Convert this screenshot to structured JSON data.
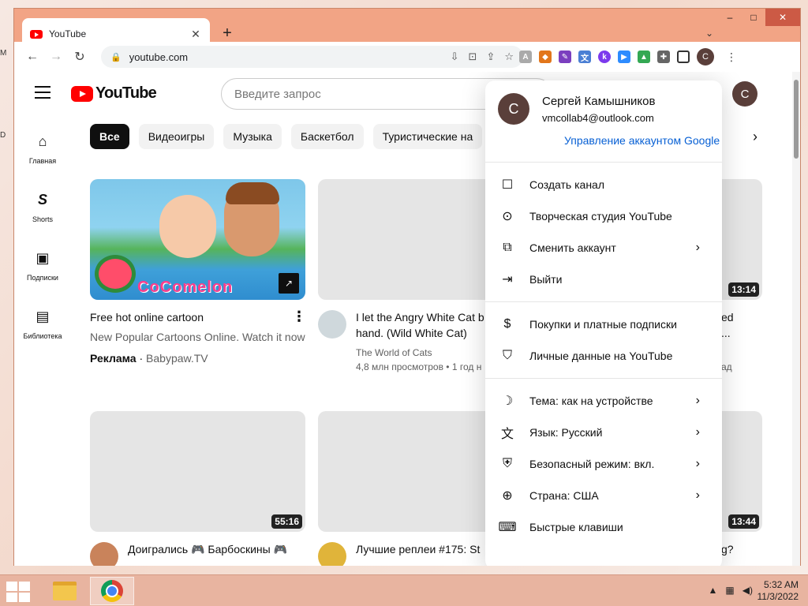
{
  "window": {
    "controls": {
      "minimize": "–",
      "maximize": "□",
      "close": "✕"
    },
    "tab": {
      "title": "YouTube",
      "close": "✕"
    },
    "new_tab": "+",
    "tab_menu": "⌄"
  },
  "toolbar": {
    "back": "←",
    "forward": "→",
    "reload": "↻",
    "url": "youtube.com",
    "lock_icon": "🔒",
    "profile_initial": "C"
  },
  "youtube": {
    "logo_text": "YouTube",
    "search_placeholder": "Введите запрос",
    "avatar_initial": "C",
    "guide": [
      {
        "icon": "⌂",
        "label": "Главная"
      },
      {
        "icon": "S",
        "label": "Shorts"
      },
      {
        "icon": "▣",
        "label": "Подписки"
      },
      {
        "icon": "▤",
        "label": "Библиотека"
      }
    ],
    "chips": [
      "Все",
      "Видеоигры",
      "Музыка",
      "Баскетбол",
      "Туристические на"
    ],
    "chip_next": "›",
    "videos": {
      "ad": {
        "title": "Free hot online cartoon",
        "desc": "New Popular Cartoons Online. Watch it now",
        "badge": "Реклама",
        "separator": "·",
        "advertiser": "Babypaw.TV",
        "brand": "CoComelon"
      },
      "v2": {
        "title_line1": "I let the Angry White Cat b",
        "title_line2": "hand. (Wild White Cat)",
        "channel": "The World of Cats",
        "meta": "4,8 млн просмотров • 1 год н"
      },
      "v3": {
        "duration": "13:14",
        "title_line1": "ed",
        "title_line2": "...",
        "meta": "ад"
      },
      "v4": {
        "duration": "55:16",
        "title": "Доигрались 🎮 Барбоскины 🎮"
      },
      "v5": {
        "title": "Лучшие реплеи #175: St"
      },
      "v6": {
        "duration": "13:44",
        "title": "g?"
      }
    }
  },
  "account_menu": {
    "avatar_initial": "C",
    "name": "Сергей Камышников",
    "email": "vmcollab4@outlook.com",
    "manage": "Управление аккаунтом Google",
    "sections": [
      [
        {
          "icon": "☐",
          "label": "Создать канал",
          "arrow": ""
        },
        {
          "icon": "⊙",
          "label": "Творческая студия YouTube",
          "arrow": ""
        },
        {
          "icon": "⧉",
          "label": "Сменить аккаунт",
          "arrow": "›"
        },
        {
          "icon": "⇥",
          "label": "Выйти",
          "arrow": ""
        }
      ],
      [
        {
          "icon": "$",
          "label": "Покупки и платные подписки",
          "arrow": ""
        },
        {
          "icon": "⛉",
          "label": "Личные данные на YouTube",
          "arrow": ""
        }
      ],
      [
        {
          "icon": "☽",
          "label": "Тема: как на устройстве",
          "arrow": "›"
        },
        {
          "icon": "文",
          "label": "Язык: Русский",
          "arrow": "›"
        },
        {
          "icon": "⛨",
          "label": "Безопасный режим: вкл.",
          "arrow": "›"
        },
        {
          "icon": "⊕",
          "label": "Страна: США",
          "arrow": "›"
        },
        {
          "icon": "⌨",
          "label": "Быстрые клавиши",
          "arrow": ""
        }
      ]
    ]
  },
  "taskbar": {
    "time": "5:32 AM",
    "date": "11/3/2022"
  }
}
